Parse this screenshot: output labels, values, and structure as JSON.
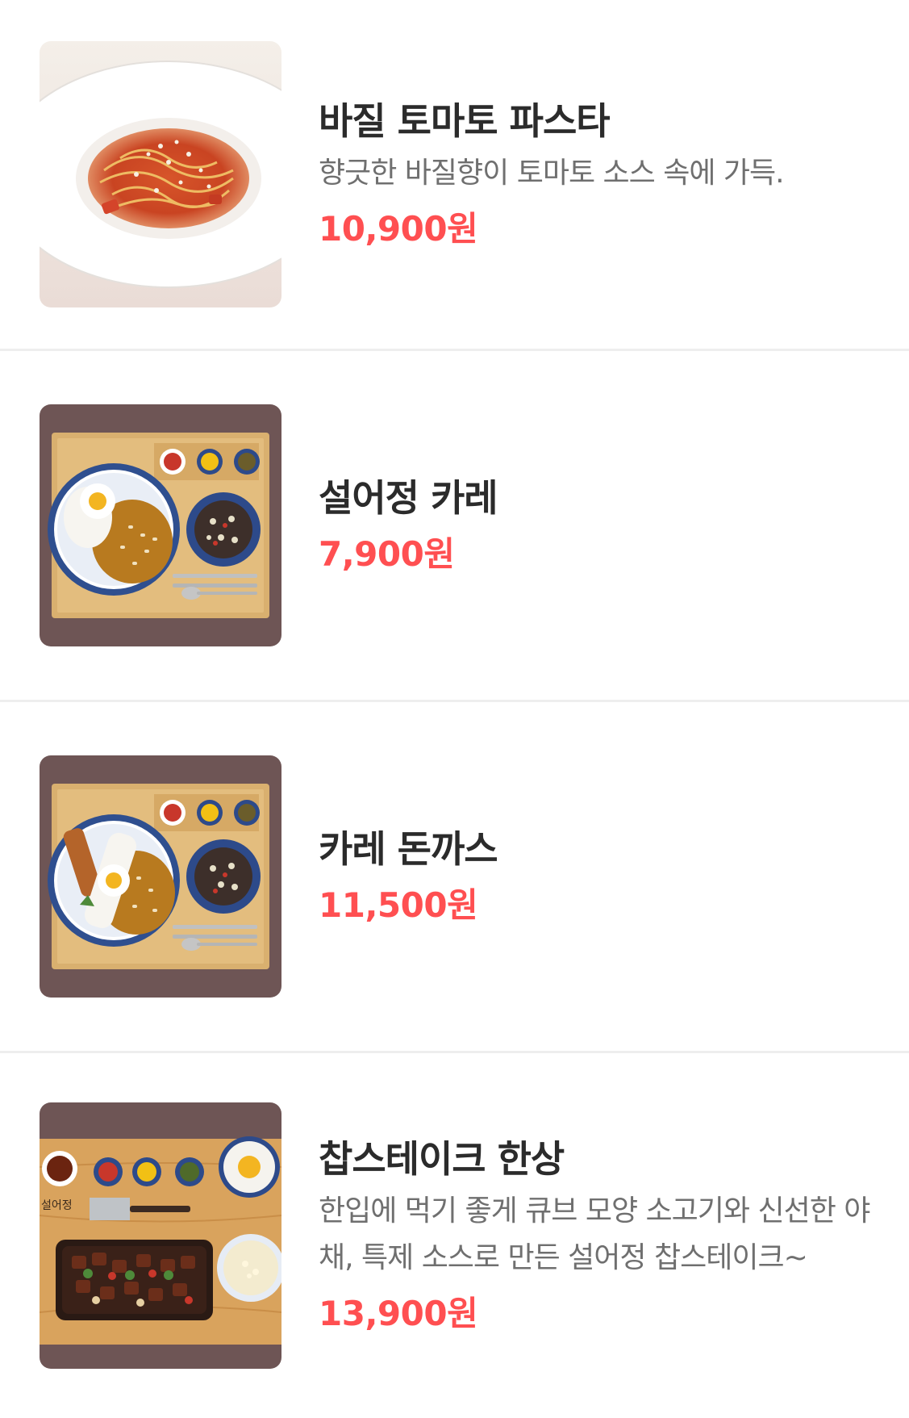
{
  "menu": {
    "items": [
      {
        "name": "바질 토마토 파스타",
        "description": "향긋한 바질향이 토마토 소스 속에 가득.",
        "price": "10,900원",
        "image": "basil-tomato-pasta-photo"
      },
      {
        "name": "설어정 카레",
        "description": "",
        "price": "7,900원",
        "image": "curry-set-photo"
      },
      {
        "name": "카레 돈까스",
        "description": "",
        "price": "11,500원",
        "image": "curry-pork-cutlet-set-photo"
      },
      {
        "name": "찹스테이크 한상",
        "description": "한입에 먹기 좋게 큐브 모양 소고기와 신선한 야채, 특제 소스로 만든 설어정 찹스테이크~",
        "price": "13,900원",
        "image": "chop-steak-set-photo",
        "image_stamp": "설어정"
      }
    ]
  },
  "colors": {
    "price": "#ff4f51",
    "title": "#2b2b2b",
    "description": "#6f6f6f",
    "divider": "#eeeeee"
  }
}
